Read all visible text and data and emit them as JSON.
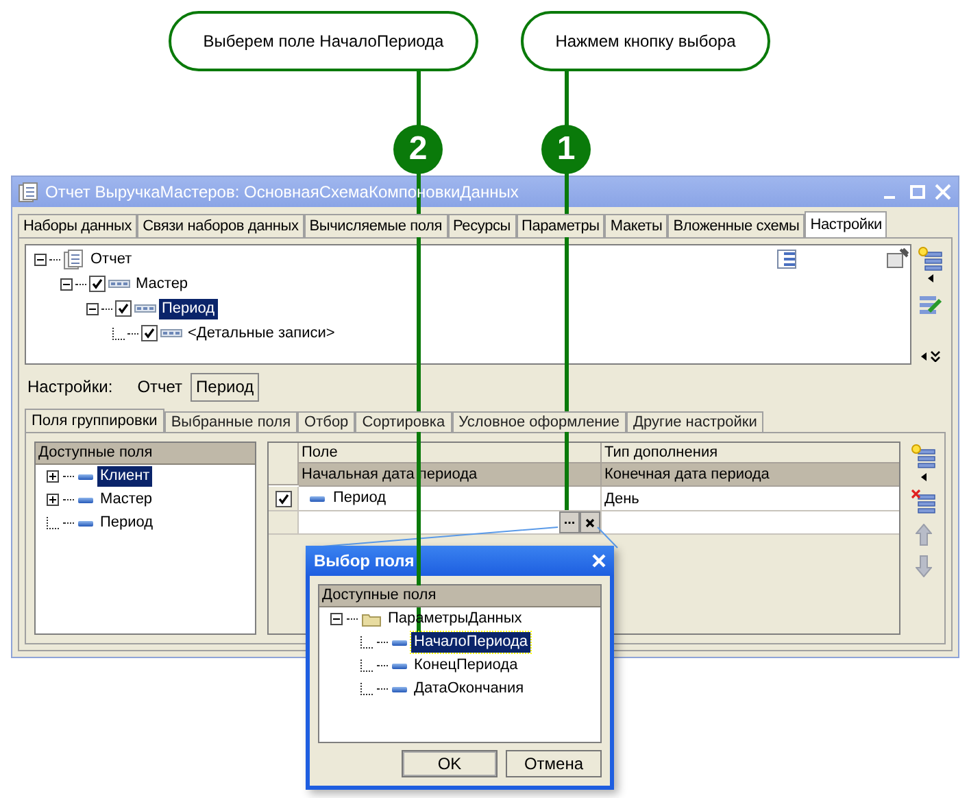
{
  "callouts": [
    {
      "number": "2",
      "text": "Выберем поле НачалоПериода"
    },
    {
      "number": "1",
      "text": "Нажмем кнопку выбора"
    }
  ],
  "window": {
    "title": "Отчет ВыручкаМастеров: ОсновнаяСхемаКомпоновкиДанных"
  },
  "tabs": [
    {
      "label": "Наборы данных",
      "selected": false
    },
    {
      "label": "Связи наборов данных",
      "selected": false
    },
    {
      "label": "Вычисляемые поля",
      "selected": false
    },
    {
      "label": "Ресурсы",
      "selected": false
    },
    {
      "label": "Параметры",
      "selected": false
    },
    {
      "label": "Макеты",
      "selected": false
    },
    {
      "label": "Вложенные схемы",
      "selected": false
    },
    {
      "label": "Настройки",
      "selected": true
    }
  ],
  "structure_tree": [
    {
      "label": "Отчет",
      "kind": "report",
      "expanded": true,
      "selected": false,
      "children": [
        {
          "label": "Мастер",
          "kind": "grouping",
          "checked": true,
          "expanded": true,
          "selected": false,
          "children": [
            {
              "label": "Период",
              "kind": "grouping",
              "checked": true,
              "expanded": true,
              "selected": true,
              "children": [
                {
                  "label": "<Детальные записи>",
                  "kind": "grouping",
                  "checked": true,
                  "selected": false
                }
              ]
            }
          ]
        }
      ]
    }
  ],
  "settings": {
    "label": "Настройки:",
    "buttons": [
      {
        "label": "Отчет",
        "selected": false
      },
      {
        "label": "Период",
        "selected": true
      }
    ]
  },
  "subtabs": [
    {
      "label": "Поля группировки",
      "selected": true
    },
    {
      "label": "Выбранные поля",
      "selected": false
    },
    {
      "label": "Отбор",
      "selected": false
    },
    {
      "label": "Сортировка",
      "selected": false
    },
    {
      "label": "Условное оформление",
      "selected": false
    },
    {
      "label": "Другие настройки",
      "selected": false
    }
  ],
  "available_fields": {
    "header": "Доступные поля",
    "items": [
      {
        "label": "Клиент",
        "expanded": false,
        "selected": true
      },
      {
        "label": "Мастер",
        "expanded": false,
        "selected": false
      },
      {
        "label": "Период",
        "selected": false
      }
    ]
  },
  "grouping_table": {
    "columns": [
      {
        "label": "Поле",
        "sublabel": "Начальная дата периода"
      },
      {
        "label": "Тип дополнения",
        "sublabel": "Конечная дата периода"
      }
    ],
    "rows": [
      {
        "checked": true,
        "field": "Период",
        "addition": "День"
      }
    ],
    "edit_button": "..."
  },
  "dialog": {
    "title": "Выбор поля",
    "header": "Доступные поля",
    "tree": [
      {
        "label": "ПараметрыДанных",
        "expanded": true,
        "selected": false,
        "children": [
          {
            "label": "НачалоПериода",
            "selected": true
          },
          {
            "label": "КонецПериода",
            "selected": false
          },
          {
            "label": "ДатаОкончания",
            "selected": false
          }
        ]
      }
    ],
    "buttons": [
      "OK",
      "Отмена"
    ]
  }
}
